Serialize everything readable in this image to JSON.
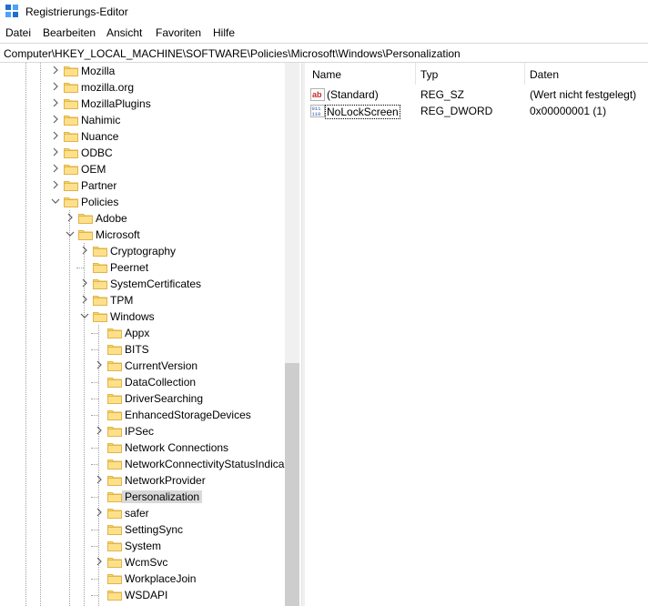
{
  "window": {
    "title": "Registrierungs-Editor"
  },
  "menu": [
    "Datei",
    "Bearbeiten",
    "Ansicht",
    "Favoriten",
    "Hilfe"
  ],
  "address": "Computer\\HKEY_LOCAL_MACHINE\\SOFTWARE\\Policies\\Microsoft\\Windows\\Personalization",
  "tree": [
    {
      "label": "Mozilla",
      "level": 0,
      "chevron": "right"
    },
    {
      "label": "mozilla.org",
      "level": 0,
      "chevron": "right"
    },
    {
      "label": "MozillaPlugins",
      "level": 0,
      "chevron": "right"
    },
    {
      "label": "Nahimic",
      "level": 0,
      "chevron": "right"
    },
    {
      "label": "Nuance",
      "level": 0,
      "chevron": "right"
    },
    {
      "label": "ODBC",
      "level": 0,
      "chevron": "right"
    },
    {
      "label": "OEM",
      "level": 0,
      "chevron": "right"
    },
    {
      "label": "Partner",
      "level": 0,
      "chevron": "right"
    },
    {
      "label": "Policies",
      "level": 0,
      "chevron": "down"
    },
    {
      "label": "Adobe",
      "level": 1,
      "chevron": "right"
    },
    {
      "label": "Microsoft",
      "level": 1,
      "chevron": "down"
    },
    {
      "label": "Cryptography",
      "level": 2,
      "chevron": "right"
    },
    {
      "label": "Peernet",
      "level": 2,
      "chevron": "none"
    },
    {
      "label": "SystemCertificates",
      "level": 2,
      "chevron": "right"
    },
    {
      "label": "TPM",
      "level": 2,
      "chevron": "right"
    },
    {
      "label": "Windows",
      "level": 2,
      "chevron": "down"
    },
    {
      "label": "Appx",
      "level": 3,
      "chevron": "none"
    },
    {
      "label": "BITS",
      "level": 3,
      "chevron": "none"
    },
    {
      "label": "CurrentVersion",
      "level": 3,
      "chevron": "right"
    },
    {
      "label": "DataCollection",
      "level": 3,
      "chevron": "none"
    },
    {
      "label": "DriverSearching",
      "level": 3,
      "chevron": "none"
    },
    {
      "label": "EnhancedStorageDevices",
      "level": 3,
      "chevron": "none"
    },
    {
      "label": "IPSec",
      "level": 3,
      "chevron": "right"
    },
    {
      "label": "Network Connections",
      "level": 3,
      "chevron": "none"
    },
    {
      "label": "NetworkConnectivityStatusIndica",
      "level": 3,
      "chevron": "none"
    },
    {
      "label": "NetworkProvider",
      "level": 3,
      "chevron": "right"
    },
    {
      "label": "Personalization",
      "level": 3,
      "chevron": "none",
      "selected": true
    },
    {
      "label": "safer",
      "level": 3,
      "chevron": "right"
    },
    {
      "label": "SettingSync",
      "level": 3,
      "chevron": "none"
    },
    {
      "label": "System",
      "level": 3,
      "chevron": "none"
    },
    {
      "label": "WcmSvc",
      "level": 3,
      "chevron": "right"
    },
    {
      "label": "WorkplaceJoin",
      "level": 3,
      "chevron": "none"
    },
    {
      "label": "WSDAPI",
      "level": 3,
      "chevron": "none"
    }
  ],
  "columns": {
    "name": "Name",
    "type": "Typ",
    "data": "Daten"
  },
  "values": [
    {
      "name": "(Standard)",
      "type": "REG_SZ",
      "data": "(Wert nicht festgelegt)",
      "icon": "string-value-icon"
    },
    {
      "name": "NoLockScreen",
      "type": "REG_DWORD",
      "data": "0x00000001 (1)",
      "icon": "binary-value-icon",
      "focused": true
    }
  ]
}
